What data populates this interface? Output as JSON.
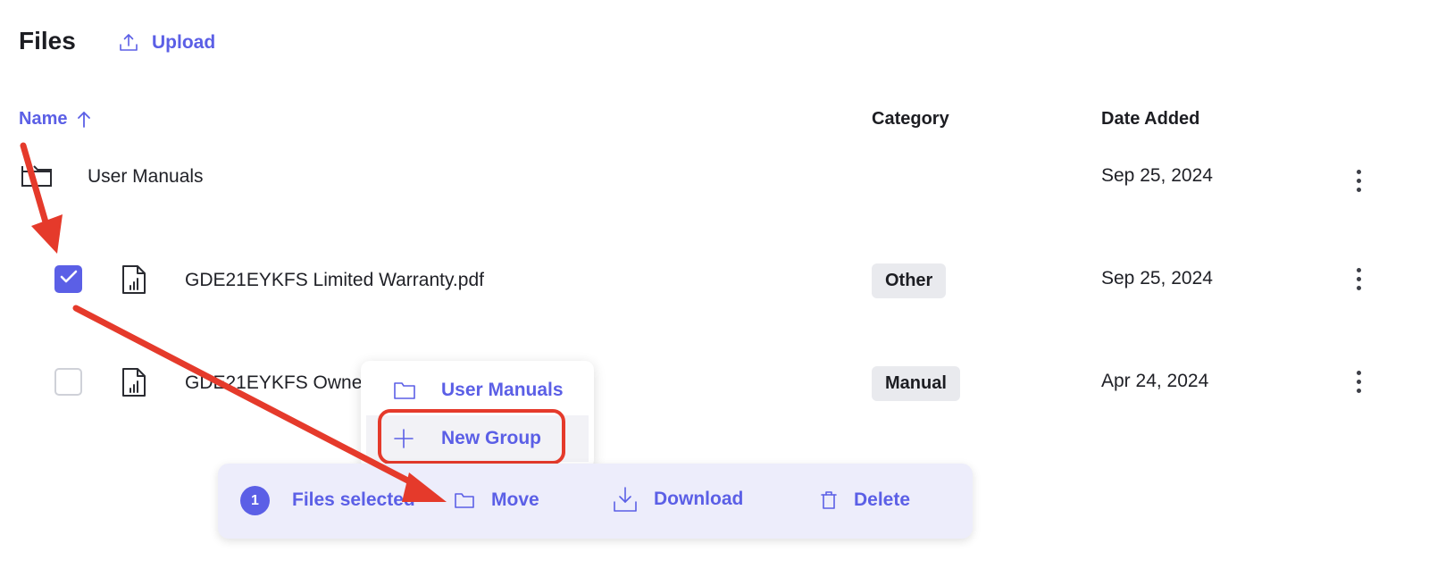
{
  "header": {
    "title": "Files",
    "upload_label": "Upload",
    "upload_icon": "upload-icon"
  },
  "table": {
    "columns": {
      "name": "Name",
      "category": "Category",
      "date_added": "Date Added"
    },
    "sort_icon": "arrow-up-icon",
    "rows": [
      {
        "name": "User Manuals",
        "category": "",
        "date": "Sep 25, 2024",
        "type": "folder"
      },
      {
        "name": "GDE21EYKFS Limited Warranty.pdf",
        "category": "Other",
        "date": "Sep 25, 2024",
        "type": "file",
        "checked": true
      },
      {
        "name": "GDE21EYKFS Owne",
        "category": "Manual",
        "date": "Apr 24, 2024",
        "type": "file",
        "checked": false
      }
    ]
  },
  "move_menu": {
    "items": [
      {
        "label": "User Manuals",
        "icon": "folder-icon"
      },
      {
        "label": "New Group",
        "icon": "plus-icon"
      }
    ]
  },
  "selection_bar": {
    "count": "1",
    "selected_label": "Files selected",
    "move_label": "Move",
    "download_label": "Download",
    "delete_label": "Delete"
  },
  "colors": {
    "accent": "#5b5fe6",
    "annotation": "#e53a2b",
    "bar_bg": "#ededfb",
    "badge_bg": "#e9eaee"
  }
}
